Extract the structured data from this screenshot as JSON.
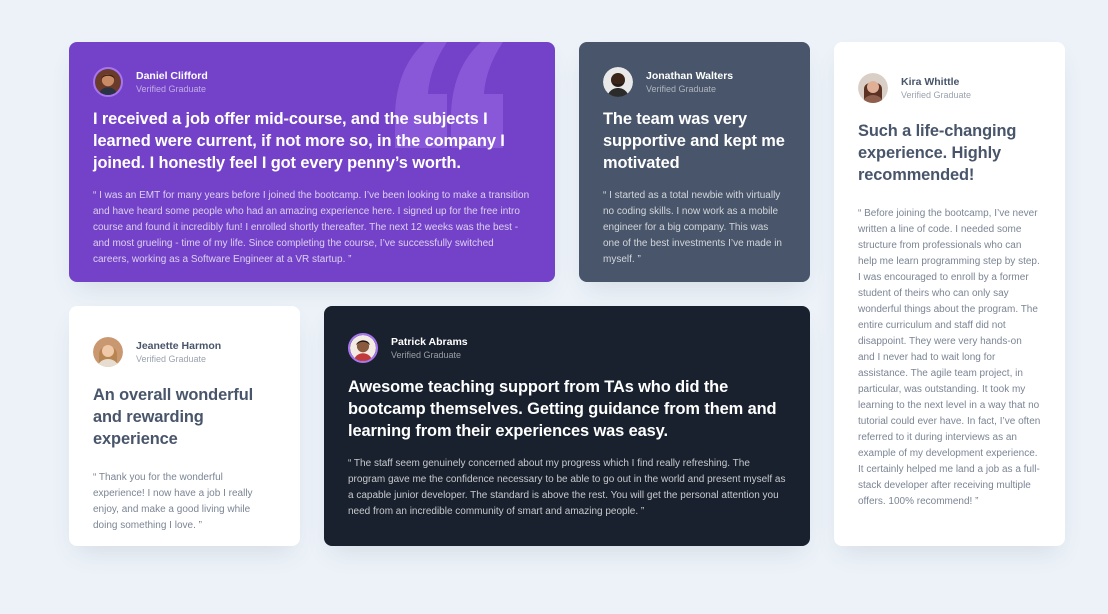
{
  "colors": {
    "background": "#ecf2f8",
    "purple": "#7442c8",
    "grayish_blue": "#48556a",
    "dark_blackish_blue": "#19212e",
    "white": "#ffffff",
    "light_violet_border": "#a775f1"
  },
  "testimonials": {
    "daniel": {
      "name": "Daniel Clifford",
      "status": "Verified Graduate",
      "headline": "I received a job offer mid-course, and the subjects I learned were current, if not more so, in the company I joined. I honestly feel I got every penny’s worth.",
      "body": "“ I was an EMT for many years before I joined the bootcamp. I’ve been looking to make a transition and have heard some people who had an amazing experience here. I signed up for the free intro course and found it incredibly fun! I enrolled shortly thereafter. The next 12 weeks was the best - and most grueling - time of my life. Since completing the course, I’ve successfully switched careers, working as a Software Engineer at a VR startup. ”",
      "decoration_icon": "quotation-mark-icon"
    },
    "jonathan": {
      "name": "Jonathan Walters",
      "status": "Verified Graduate",
      "headline": "The team was very supportive and kept me motivated",
      "body": "“ I started as a total newbie with virtually no coding skills. I now work as a mobile engineer for a big company. This was one of the best investments I’ve made in myself. ”"
    },
    "kira": {
      "name": "Kira Whittle",
      "status": "Verified Graduate",
      "headline": "Such a life-changing experience. Highly recommended!",
      "body": "“ Before joining the bootcamp, I’ve never written a line of code. I needed some structure from professionals who can help me learn programming step by step. I was encouraged to enroll by a former student of theirs who can only say wonderful things about the program. The entire curriculum and staff did not disappoint. They were very hands-on and I never had to wait long for assistance. The agile team project, in particular, was outstanding. It took my learning to the next level in a way that no tutorial could ever have. In fact, I’ve often referred to it during interviews as an example of my development experience. It certainly helped me land a job as a full-stack developer after receiving multiple offers. 100% recommend! ”"
    },
    "jeanette": {
      "name": "Jeanette Harmon",
      "status": "Verified Graduate",
      "headline": "An overall wonderful and rewarding experience",
      "body": "“ Thank you for the wonderful experience! I now have a job I really enjoy, and make a good living while doing something I love. ”"
    },
    "patrick": {
      "name": "Patrick Abrams",
      "status": "Verified Graduate",
      "headline": "Awesome teaching support from TAs who did the bootcamp themselves. Getting guidance from them and learning from their experiences was easy.",
      "body": "“ The staff seem genuinely concerned about my progress which I find really refreshing. The program gave me the confidence necessary to be able to go out in the world and present myself as a capable junior developer. The standard is above the rest. You will get the personal attention you need from an incredible community of smart and amazing people. ”"
    }
  }
}
